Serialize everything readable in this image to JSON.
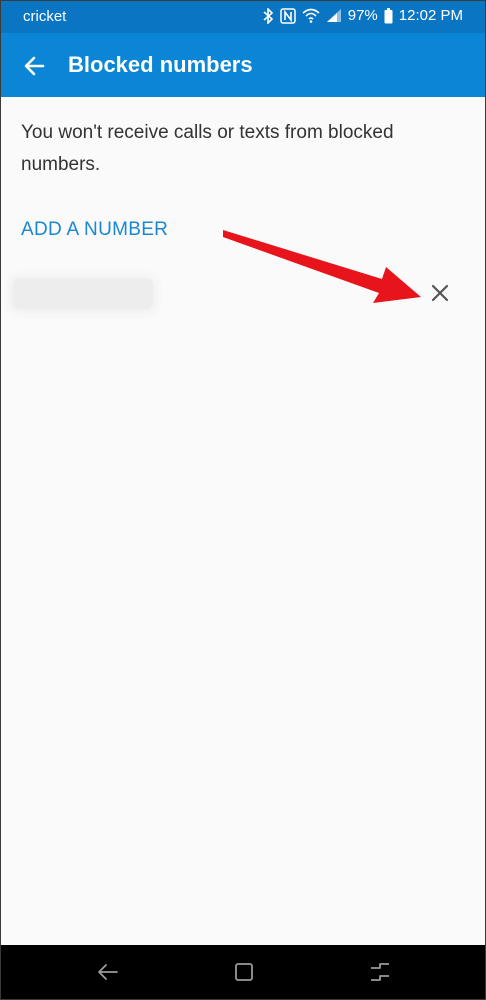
{
  "status_bar": {
    "carrier": "cricket",
    "battery": "97%",
    "time": "12:02 PM",
    "icons": [
      "bluetooth-icon",
      "nfc-icon",
      "wifi-icon",
      "signal-icon",
      "battery-icon"
    ]
  },
  "app_bar": {
    "title": "Blocked numbers",
    "back_icon": "arrow-left-icon"
  },
  "content": {
    "info_text": "You won't receive calls or texts from blocked numbers.",
    "add_number_label": "ADD A NUMBER",
    "blocked_numbers": [
      {
        "remove_icon": "close-icon"
      }
    ]
  },
  "annotation": {
    "arrow_color": "#e8141c"
  },
  "nav_bar": {
    "buttons": [
      "back-nav-icon",
      "home-nav-icon",
      "recents-nav-icon"
    ]
  },
  "colors": {
    "status_bar": "#0a75c2",
    "app_bar": "#0b86d6",
    "accent": "#1b87d0",
    "background": "#fafafa"
  }
}
